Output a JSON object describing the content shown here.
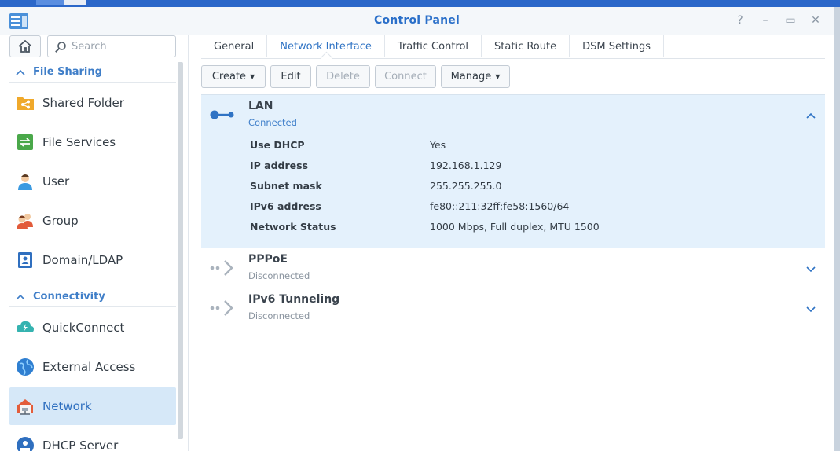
{
  "window": {
    "title": "Control Panel"
  },
  "controls": {
    "help": "?",
    "minimize": "–",
    "maximize": "▭",
    "close": "✕"
  },
  "search": {
    "placeholder": "Search"
  },
  "sidebar": {
    "sections": [
      {
        "label": "File Sharing",
        "items": [
          {
            "label": "Shared Folder",
            "icon": "shared-folder-icon"
          },
          {
            "label": "File Services",
            "icon": "file-services-icon"
          },
          {
            "label": "User",
            "icon": "user-icon"
          },
          {
            "label": "Group",
            "icon": "group-icon"
          },
          {
            "label": "Domain/LDAP",
            "icon": "domain-ldap-icon"
          }
        ]
      },
      {
        "label": "Connectivity",
        "items": [
          {
            "label": "QuickConnect",
            "icon": "quickconnect-icon"
          },
          {
            "label": "External Access",
            "icon": "external-access-icon"
          },
          {
            "label": "Network",
            "icon": "network-icon",
            "active": true
          },
          {
            "label": "DHCP Server",
            "icon": "dhcp-server-icon"
          }
        ]
      }
    ]
  },
  "tabs": [
    {
      "label": "General",
      "active": false
    },
    {
      "label": "Network Interface",
      "active": true
    },
    {
      "label": "Traffic Control",
      "active": false
    },
    {
      "label": "Static Route",
      "active": false
    },
    {
      "label": "DSM Settings",
      "active": false
    }
  ],
  "toolbar": {
    "create": "Create",
    "edit": "Edit",
    "delete": "Delete",
    "connect": "Connect",
    "manage": "Manage"
  },
  "interfaces": [
    {
      "name": "LAN",
      "status": "Connected",
      "expanded": true,
      "details": [
        {
          "label": "Use DHCP",
          "value": "Yes"
        },
        {
          "label": "IP address",
          "value": "192.168.1.129"
        },
        {
          "label": "Subnet mask",
          "value": "255.255.255.0"
        },
        {
          "label": "IPv6 address",
          "value": "fe80::211:32ff:fe58:1560/64"
        },
        {
          "label": "Network Status",
          "value": "1000 Mbps, Full duplex, MTU 1500"
        }
      ]
    },
    {
      "name": "PPPoE",
      "status": "Disconnected",
      "expanded": false
    },
    {
      "name": "IPv6 Tunneling",
      "status": "Disconnected",
      "expanded": false
    }
  ],
  "colors": {
    "accent": "#2f73c4",
    "selected_bg": "#d6e8f8",
    "expanded_bg": "#e4f1fc"
  }
}
